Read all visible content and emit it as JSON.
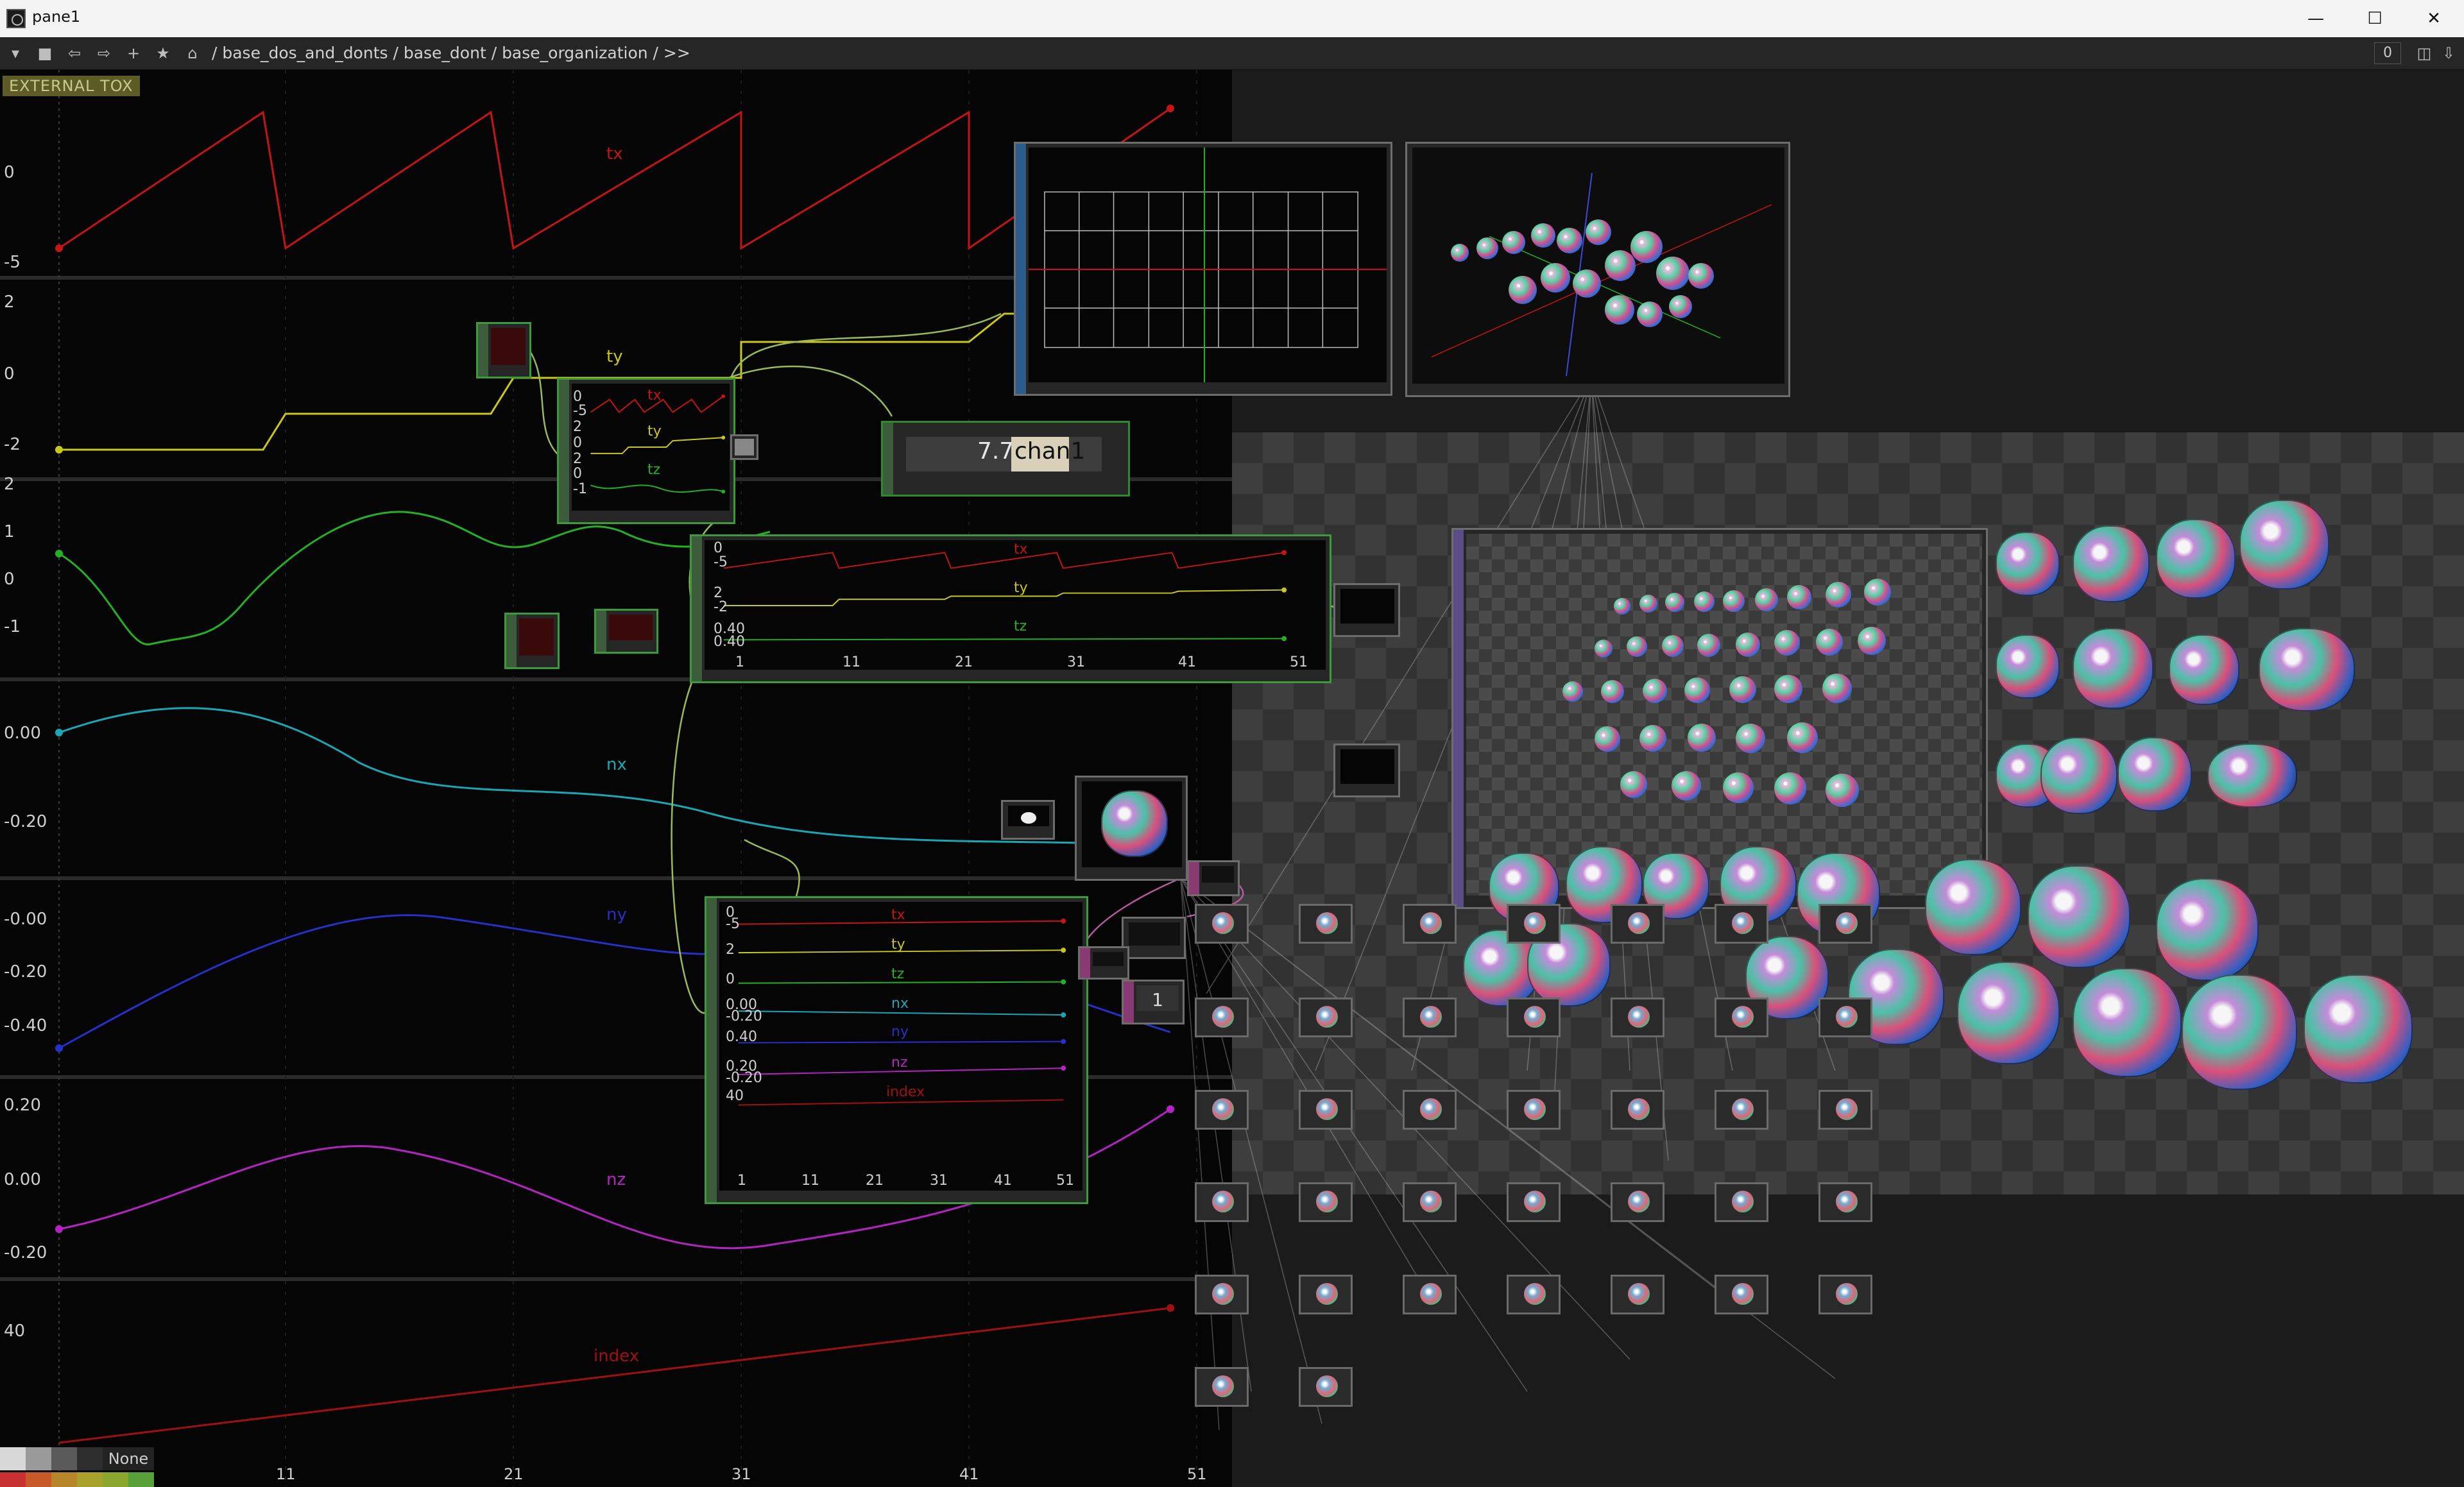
{
  "window": {
    "title": "pane1",
    "controls": [
      "minimize",
      "maximize",
      "close"
    ]
  },
  "toolbar": {
    "buttons": [
      "menu-down",
      "stop",
      "back",
      "forward",
      "add",
      "star",
      "home"
    ],
    "path": "/ base_dos_and_donts / base_dont / base_organization / >>",
    "counter": "0"
  },
  "network": {
    "tag": "EXTERNAL TOX",
    "y_ticks": {
      "tx": [
        "0",
        "-5"
      ],
      "ty": [
        "2",
        "0",
        "-2"
      ],
      "tz": [
        "2",
        "1",
        "0",
        "-1"
      ],
      "nx": [
        "0.00",
        "-0.20"
      ],
      "ny": [
        "-0.00",
        "-0.20",
        "-0.40"
      ],
      "nz": [
        "0.20",
        "0.00",
        "-0.20"
      ],
      "index": [
        "40"
      ]
    },
    "x_ticks": [
      "11",
      "21",
      "31",
      "41",
      "51"
    ],
    "channel_labels": [
      "tx",
      "ty",
      "tz",
      "nx",
      "ny",
      "nz",
      "index"
    ],
    "value_display": {
      "value": "7.727",
      "channel": "chan1"
    },
    "count_display": "1",
    "mini_graph_1": {
      "x_ticks": [
        "1",
        "11",
        "21",
        "31",
        "41",
        "51"
      ],
      "labels": [
        "tx",
        "ty",
        "tz"
      ],
      "ticks": [
        "0",
        "-5",
        "2",
        "-2",
        "0.40",
        "0.40"
      ]
    },
    "mini_graph_2": {
      "x_ticks": [
        "1",
        "11",
        "21",
        "31",
        "41",
        "51"
      ],
      "labels": [
        "tx",
        "ty",
        "tz",
        "nx",
        "ny",
        "nz",
        "index"
      ],
      "ticks": [
        "0",
        "-5",
        "2",
        "0",
        "0.00",
        "-0.20",
        "0.40",
        "0.20",
        "40",
        "-0.20"
      ]
    },
    "small_graph": {
      "labels": [
        "tx",
        "ty",
        "tz"
      ],
      "ticks": [
        "0",
        "-5",
        "2",
        "0",
        "2",
        "0",
        "-1"
      ]
    }
  },
  "colors": {
    "tx": "#c41414",
    "ty": "#c8c81a",
    "tz": "#23b023",
    "nx": "#1aa7b5",
    "ny": "#2530c8",
    "nz": "#b523c4",
    "index": "#a01010"
  },
  "palette": {
    "none_label": "None"
  }
}
